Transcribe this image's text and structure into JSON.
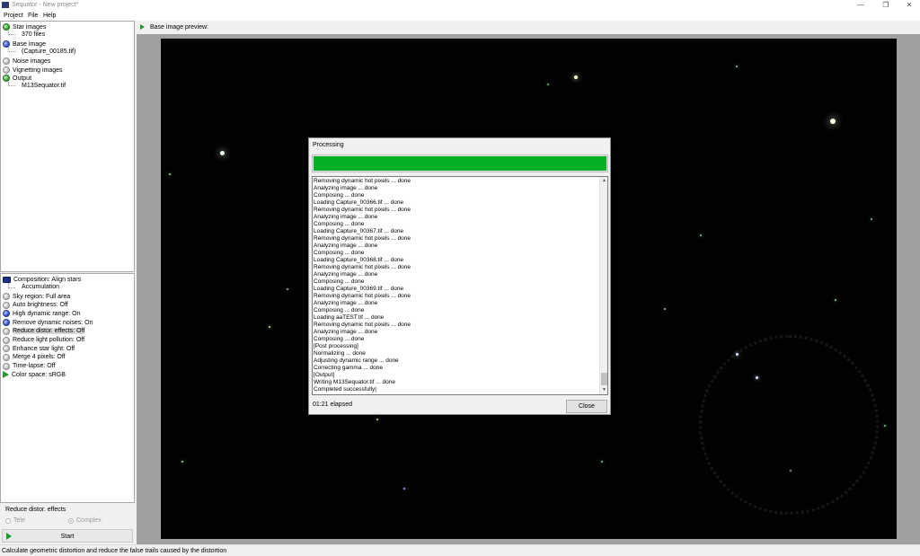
{
  "window": {
    "title": "Sequator - New project*",
    "minimize_glyph": "—",
    "maximize_glyph": "❐",
    "close_glyph": "✕"
  },
  "menu": [
    "Project",
    "File",
    "Help"
  ],
  "tree": {
    "star_images": {
      "label": "Star images",
      "child": "370 files",
      "icon": "green-ball-icon"
    },
    "base_image": {
      "label": "Base image",
      "child": "(Capture_00185.tif)",
      "icon": "blue-ball-icon"
    },
    "noise_images": {
      "label": "Noise images",
      "icon": "gray-ball-icon"
    },
    "vignetting_images": {
      "label": "Vignetting images",
      "icon": "gray-ball-icon"
    },
    "output": {
      "label": "Output",
      "child": "M13Sequator.tif",
      "icon": "green-ball-icon"
    }
  },
  "options": {
    "composition": {
      "label": "Composition: Align stars",
      "child": "Accumulation"
    },
    "items": [
      {
        "label": "Sky region: Full area",
        "icon": "gray"
      },
      {
        "label": "Auto brightness: Off",
        "icon": "gray"
      },
      {
        "label": "High dynamic range: On",
        "icon": "blue"
      },
      {
        "label": "Remove dynamic noises: On",
        "icon": "blue"
      },
      {
        "label": "Reduce distor. effects: Off",
        "icon": "gray"
      },
      {
        "label": "Reduce light pollution: Off",
        "icon": "gray"
      },
      {
        "label": "Enhance star light: Off",
        "icon": "gray"
      },
      {
        "label": "Merge 4 pixels: Off",
        "icon": "gray"
      },
      {
        "label": "Time-lapse: Off",
        "icon": "gray"
      }
    ],
    "color_space": "Color space: sRGB"
  },
  "detail_group": {
    "title": "Reduce distor. effects",
    "radio_tele": "Tele",
    "radio_complex": "Complex"
  },
  "start_button": "Start",
  "status_text": "Calculate geometric distortion and reduce the false trails caused by the distortion",
  "preview": {
    "label": "Base image preview:"
  },
  "dialog": {
    "title": "Processing",
    "progress": 1.0,
    "progress_color": "#06b025",
    "log": [
      "Removing dynamic hot pixels ... done",
      "Analyzing image ... done",
      "Composing ... done",
      "Loading Capture_00366.tif ... done",
      "Removing dynamic hot pixels ... done",
      "Analyzing image ... done",
      "Composing ... done",
      "Loading Capture_00367.tif ... done",
      "Removing dynamic hot pixels ... done",
      "Analyzing image ... done",
      "Composing ... done",
      "Loading Capture_00368.tif ... done",
      "Removing dynamic hot pixels ... done",
      "Analyzing image ... done",
      "Composing ... done",
      "Loading Capture_00369.tif ... done",
      "Removing dynamic hot pixels ... done",
      "Analyzing image ... done",
      "Composing ... done",
      "Loading aaTEST.tif ... done",
      "Removing dynamic hot pixels ... done",
      "Analyzing image ... done",
      "Composing ... done",
      "[Post processing]",
      "Normalizing ... done",
      "Adjusting dynamic range ... done",
      "Correcting gamma ... done",
      "[Output]",
      "Writing M13Sequator.tif ... done",
      "Completed successfully|"
    ],
    "elapsed": "01:21 elapsed",
    "close_button": "Close"
  }
}
